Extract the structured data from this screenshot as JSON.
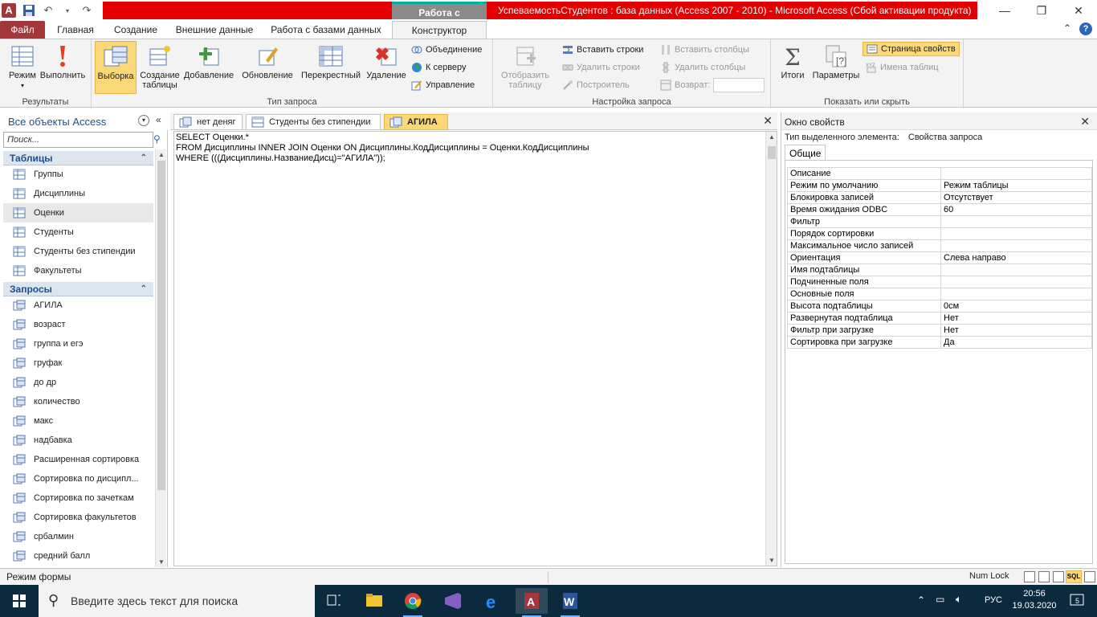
{
  "titlebar": {
    "context_tab_header": "Работа с запросами",
    "app_title": "УспеваемостьСтудентов : база данных (Access 2007 - 2010)  -  Microsoft Access (Сбой активации продукта)"
  },
  "tabs": {
    "file": "Файл",
    "home": "Главная",
    "create": "Создание",
    "external": "Внешние данные",
    "dbtools": "Работа с базами данных",
    "design": "Конструктор"
  },
  "ribbon": {
    "results": {
      "label": "Результаты",
      "view": "Режим",
      "run": "Выполнить"
    },
    "query_type": {
      "label": "Тип запроса",
      "select": "Выборка",
      "make_table": "Создание таблицы",
      "append": "Добавление",
      "update": "Обновление",
      "crosstab": "Перекрестный",
      "delete": "Удаление",
      "union": "Объединение",
      "pass_through": "К серверу",
      "data_definition": "Управление"
    },
    "setup": {
      "label": "Настройка запроса",
      "show_table": "Отобразить таблицу",
      "insert_rows": "Вставить строки",
      "delete_rows": "Удалить строки",
      "builder": "Построитель",
      "insert_columns": "Вставить столбцы",
      "delete_columns": "Удалить столбцы",
      "return": "Возврат:"
    },
    "show_hide": {
      "label": "Показать или скрыть",
      "totals": "Итоги",
      "parameters": "Параметры",
      "property_sheet": "Страница свойств",
      "table_names": "Имена таблиц"
    }
  },
  "nav": {
    "title": "Все объекты Access",
    "search_placeholder": "Поиск...",
    "tables_header": "Таблицы",
    "tables": [
      "Группы",
      "Дисциплины",
      "Оценки",
      "Студенты",
      "Студенты без стипендии",
      "Факультеты"
    ],
    "queries_header": "Запросы",
    "queries": [
      "АГИЛА",
      "возраст",
      "группа и егэ",
      "груфак",
      "до др",
      "количество",
      "макс",
      "надбавка",
      "Расширенная сортировка",
      "Сортировка по дисципл...",
      "Сортировка по зачеткам",
      "Сортировка факультетов",
      "србалмин",
      "средний балл"
    ]
  },
  "doctabs": [
    "нет деняг",
    "Студенты без стипендии",
    "АГИЛА"
  ],
  "sql": [
    "SELECT Оценки.*",
    "FROM Дисциплины INNER JOIN Оценки ON Дисциплины.КодДисциплины = Оценки.КодДисциплины",
    "WHERE (((Дисциплины.НазваниеДисц)=\"АГИЛА\"));"
  ],
  "props": {
    "title": "Окно свойств",
    "selection_type_label": "Тип выделенного элемента:",
    "selection_type_value": "Свойства запроса",
    "tab": "Общие",
    "rows": [
      {
        "name": "Описание",
        "value": ""
      },
      {
        "name": "Режим по умолчанию",
        "value": "Режим таблицы"
      },
      {
        "name": "Блокировка записей",
        "value": "Отсутствует"
      },
      {
        "name": "Время ожидания ODBC",
        "value": "60"
      },
      {
        "name": "Фильтр",
        "value": ""
      },
      {
        "name": "Порядок сортировки",
        "value": ""
      },
      {
        "name": "Максимальное число записей",
        "value": ""
      },
      {
        "name": "Ориентация",
        "value": "Слева направо"
      },
      {
        "name": "Имя подтаблицы",
        "value": ""
      },
      {
        "name": "Подчиненные поля",
        "value": ""
      },
      {
        "name": "Основные поля",
        "value": ""
      },
      {
        "name": "Высота подтаблицы",
        "value": "0см"
      },
      {
        "name": "Развернутая подтаблица",
        "value": "Нет"
      },
      {
        "name": "Фильтр при загрузке",
        "value": "Нет"
      },
      {
        "name": "Сортировка при загрузке",
        "value": "Да"
      }
    ]
  },
  "status": {
    "left": "Режим формы",
    "numlock": "Num Lock",
    "sql_view": "SQL"
  },
  "taskbar": {
    "search_placeholder": "Введите здесь текст для поиска",
    "lang": "РУС",
    "time": "20:56",
    "date": "19.03.2020",
    "notifications": "5"
  },
  "colors": {
    "title_red": "#e20000",
    "file_tab": "#a4373a",
    "selected_yellow": "#fbd877",
    "taskbar": "#0b2a3e"
  }
}
